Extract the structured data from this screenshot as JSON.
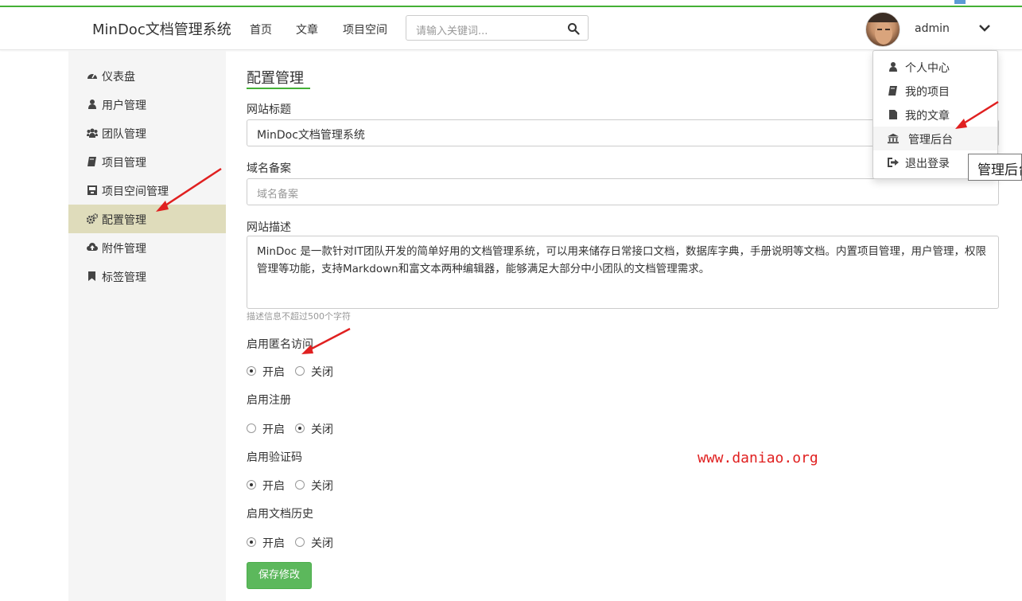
{
  "header": {
    "brand": "MinDoc文档管理系统",
    "nav": [
      "首页",
      "文章",
      "项目空间"
    ],
    "search_placeholder": "请输入关键词...",
    "username": "admin"
  },
  "sidebar": {
    "items": [
      {
        "label": "仪表盘",
        "icon": "dashboard-icon"
      },
      {
        "label": "用户管理",
        "icon": "user-icon"
      },
      {
        "label": "团队管理",
        "icon": "users-icon"
      },
      {
        "label": "项目管理",
        "icon": "book-icon"
      },
      {
        "label": "项目空间管理",
        "icon": "archive-icon"
      },
      {
        "label": "配置管理",
        "icon": "cogs-icon",
        "active": true
      },
      {
        "label": "附件管理",
        "icon": "cloud-upload-icon"
      },
      {
        "label": "标签管理",
        "icon": "bookmark-icon"
      }
    ]
  },
  "main": {
    "title": "配置管理",
    "site_title_label": "网站标题",
    "site_title_value": "MinDoc文档管理系统",
    "domain_label": "域名备案",
    "domain_placeholder": "域名备案",
    "desc_label": "网站描述",
    "desc_value": "MinDoc 是一款针对IT团队开发的简单好用的文档管理系统，可以用来储存日常接口文档，数据库字典，手册说明等文档。内置项目管理，用户管理，权限管理等功能，支持Markdown和富文本两种编辑器，能够满足大部分中小团队的文档管理需求。",
    "desc_hint": "描述信息不超过500个字符",
    "options": [
      {
        "label": "启用匿名访问",
        "on": "开启",
        "off": "关闭",
        "selected": "on"
      },
      {
        "label": "启用注册",
        "on": "开启",
        "off": "关闭",
        "selected": "off"
      },
      {
        "label": "启用验证码",
        "on": "开启",
        "off": "关闭",
        "selected": "on"
      },
      {
        "label": "启用文档历史",
        "on": "开启",
        "off": "关闭",
        "selected": "on"
      }
    ],
    "save_label": "保存修改"
  },
  "dropdown": {
    "items": [
      {
        "label": "个人中心",
        "icon": "user-icon"
      },
      {
        "label": "我的项目",
        "icon": "book-icon"
      },
      {
        "label": "我的文章",
        "icon": "file-icon"
      },
      {
        "label": "管理后台",
        "icon": "bank-icon",
        "hover": true
      },
      {
        "label": "退出登录",
        "icon": "sign-out-icon"
      }
    ],
    "tooltip": "管理后台"
  },
  "watermark": "www.daniao.org",
  "colors": {
    "accent": "#44b036",
    "active_item": "#dfdcbb",
    "save_button": "#5cb85c",
    "annotation_arrow": "#e02020"
  }
}
